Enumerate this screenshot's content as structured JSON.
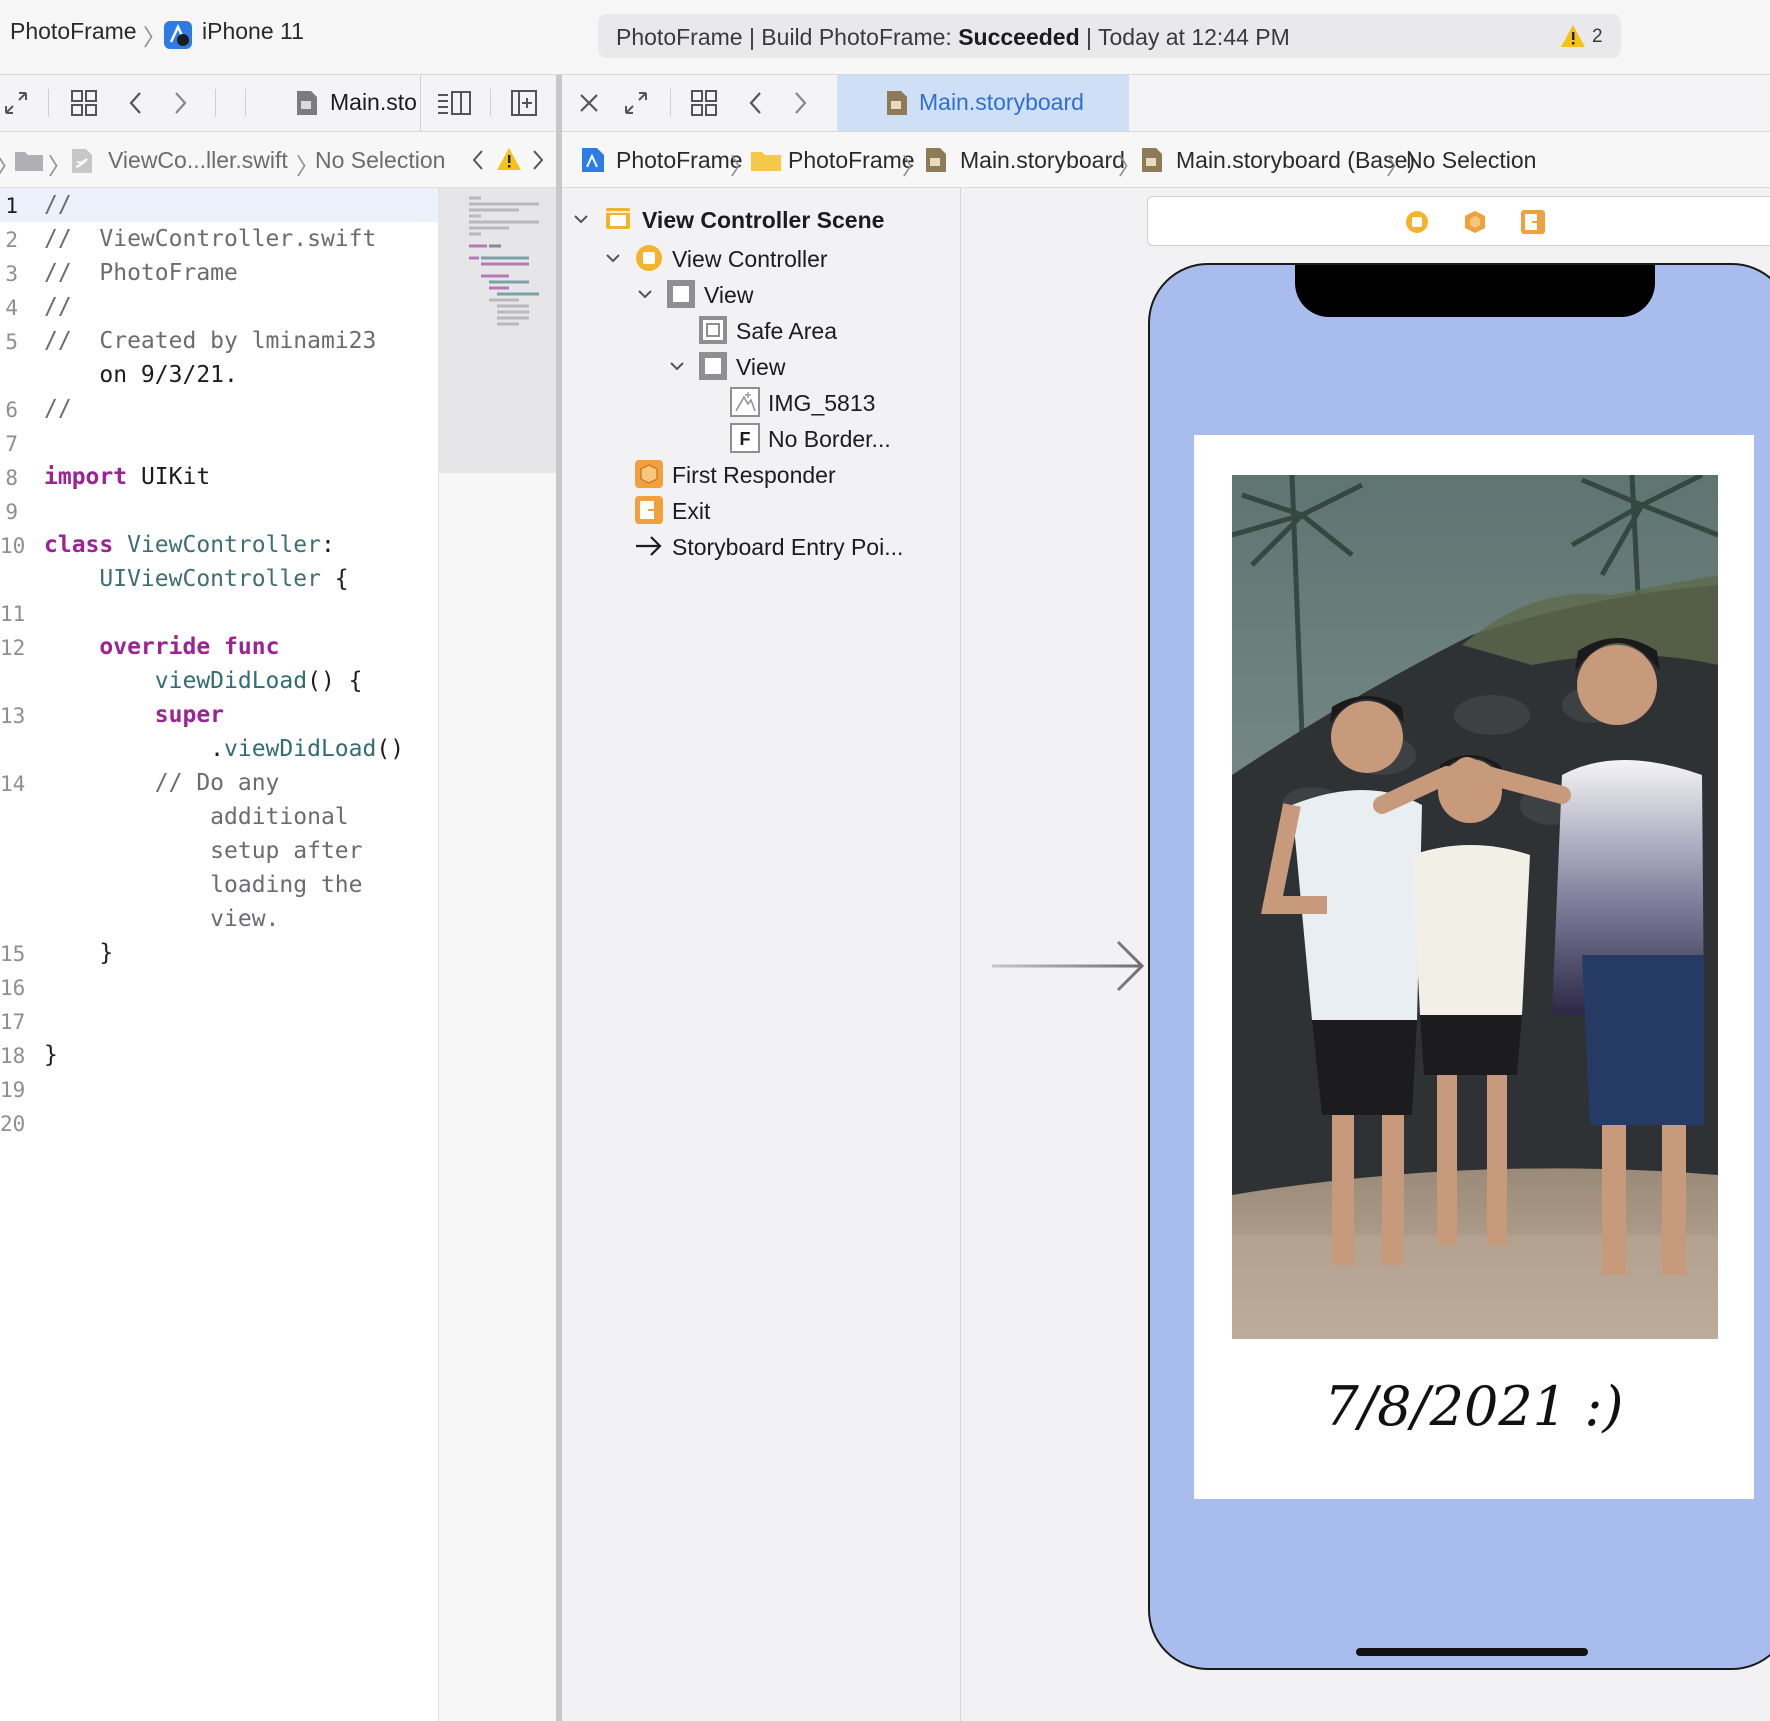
{
  "toolbar": {
    "project": "PhotoFrame",
    "device": "iPhone 11",
    "activity_prefix": "PhotoFrame | Build PhotoFrame: ",
    "activity_status": "Succeeded",
    "activity_suffix": " | Today at 12:44 PM",
    "warning_count": "2"
  },
  "left_editor": {
    "tab_label": "Main.sto",
    "jump_file": "ViewCo...ller.swift",
    "jump_selection": "No Selection",
    "lines": [
      {
        "n": "1",
        "text": "//"
      },
      {
        "n": "2",
        "text": "//  ViewController.swift"
      },
      {
        "n": "3",
        "text": "//  PhotoFrame"
      },
      {
        "n": "4",
        "text": "//"
      },
      {
        "n": "5",
        "text": "//  Created by lminami23"
      },
      {
        "n": "",
        "text": "    on 9/3/21."
      },
      {
        "n": "6",
        "text": "//"
      },
      {
        "n": "7",
        "text": ""
      },
      {
        "n": "8",
        "text": "import UIKit"
      },
      {
        "n": "9",
        "text": ""
      },
      {
        "n": "10",
        "text": "class ViewController:"
      },
      {
        "n": "",
        "text": "    UIViewController {"
      },
      {
        "n": "11",
        "text": ""
      },
      {
        "n": "12",
        "text": "    override func"
      },
      {
        "n": "",
        "text": "        viewDidLoad() {"
      },
      {
        "n": "13",
        "text": "        super"
      },
      {
        "n": "",
        "text": "            .viewDidLoad()"
      },
      {
        "n": "14",
        "text": "        // Do any"
      },
      {
        "n": "",
        "text": "            additional"
      },
      {
        "n": "",
        "text": "            setup after"
      },
      {
        "n": "",
        "text": "            loading the"
      },
      {
        "n": "",
        "text": "            view."
      },
      {
        "n": "15",
        "text": "    }"
      },
      {
        "n": "16",
        "text": ""
      },
      {
        "n": "17",
        "text": ""
      },
      {
        "n": "18",
        "text": "}"
      },
      {
        "n": "19",
        "text": ""
      },
      {
        "n": "20",
        "text": ""
      }
    ]
  },
  "right_editor": {
    "tab_label": "Main.storyboard",
    "jump": [
      "PhotoFrame",
      "PhotoFrame",
      "Main.storyboard",
      "Main.storyboard (Base)",
      "No Selection"
    ]
  },
  "outline": {
    "scene": "View Controller Scene",
    "view_controller": "View Controller",
    "view": "View",
    "safe_area": "Safe Area",
    "inner_view": "View",
    "image": "IMG_5813",
    "label": "No Border...",
    "first_responder": "First Responder",
    "exit": "Exit",
    "entry_point": "Storyboard Entry Poi..."
  },
  "canvas": {
    "caption": "7/8/2021 :)",
    "colors": {
      "background": "#a8bded",
      "frame": "#ffffff"
    }
  },
  "icons": [
    "expand-icon",
    "grid-icon",
    "chevron-left-icon",
    "chevron-right-icon",
    "storyboard-file-icon",
    "close-icon",
    "warning-icon",
    "folder-icon",
    "swift-file-icon",
    "xcode-project-icon",
    "view-controller-icon",
    "first-responder-icon",
    "exit-icon",
    "entry-arrow-icon"
  ]
}
